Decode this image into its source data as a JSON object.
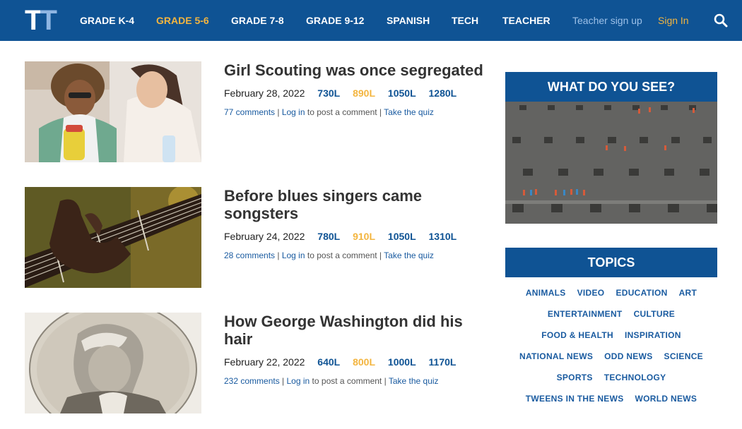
{
  "header": {
    "logo": {
      "letter1": "T",
      "letter2": "T"
    },
    "nav": [
      {
        "label": "GRADE K-4"
      },
      {
        "label": "GRADE 5-6"
      },
      {
        "label": "GRADE 7-8"
      },
      {
        "label": "GRADE 9-12"
      },
      {
        "label": "SPANISH"
      },
      {
        "label": "TECH"
      },
      {
        "label": "TEACHER"
      }
    ],
    "teacher_signup": "Teacher sign up",
    "sign_in": "Sign In"
  },
  "articles": [
    {
      "title": "Girl Scouting was once segregated",
      "date": "February 28, 2022",
      "lexiles": [
        "730L",
        "890L",
        "1050L",
        "1280L"
      ],
      "comments": "77 comments",
      "login": "Log in",
      "post_text": "to post a comment",
      "quiz": "Take the quiz"
    },
    {
      "title": "Before blues singers came songsters",
      "date": "February 24, 2022",
      "lexiles": [
        "780L",
        "910L",
        "1050L",
        "1310L"
      ],
      "comments": "28 comments",
      "login": "Log in",
      "post_text": "to post a comment",
      "quiz": "Take the quiz"
    },
    {
      "title": "How George Washington did his hair",
      "date": "February 22, 2022",
      "lexiles": [
        "640L",
        "800L",
        "1000L",
        "1170L"
      ],
      "comments": "232 comments",
      "login": "Log in",
      "post_text": "to post a comment",
      "quiz": "Take the quiz"
    }
  ],
  "sidebar": {
    "wdys_title": "WHAT DO YOU SEE?",
    "topics_title": "TOPICS",
    "topics": [
      [
        "ANIMALS",
        "VIDEO",
        "EDUCATION",
        "ART"
      ],
      [
        "ENTERTAINMENT",
        "CULTURE"
      ],
      [
        "FOOD & HEALTH",
        "INSPIRATION"
      ],
      [
        "NATIONAL NEWS",
        "ODD NEWS",
        "SCIENCE"
      ],
      [
        "SPORTS",
        "TECHNOLOGY"
      ],
      [
        "TWEENS IN THE NEWS",
        "WORLD NEWS"
      ]
    ]
  },
  "colors": {
    "header_bg": "#0f5394",
    "accent_gold": "#f3b53f",
    "link_blue": "#1a5ba0"
  }
}
